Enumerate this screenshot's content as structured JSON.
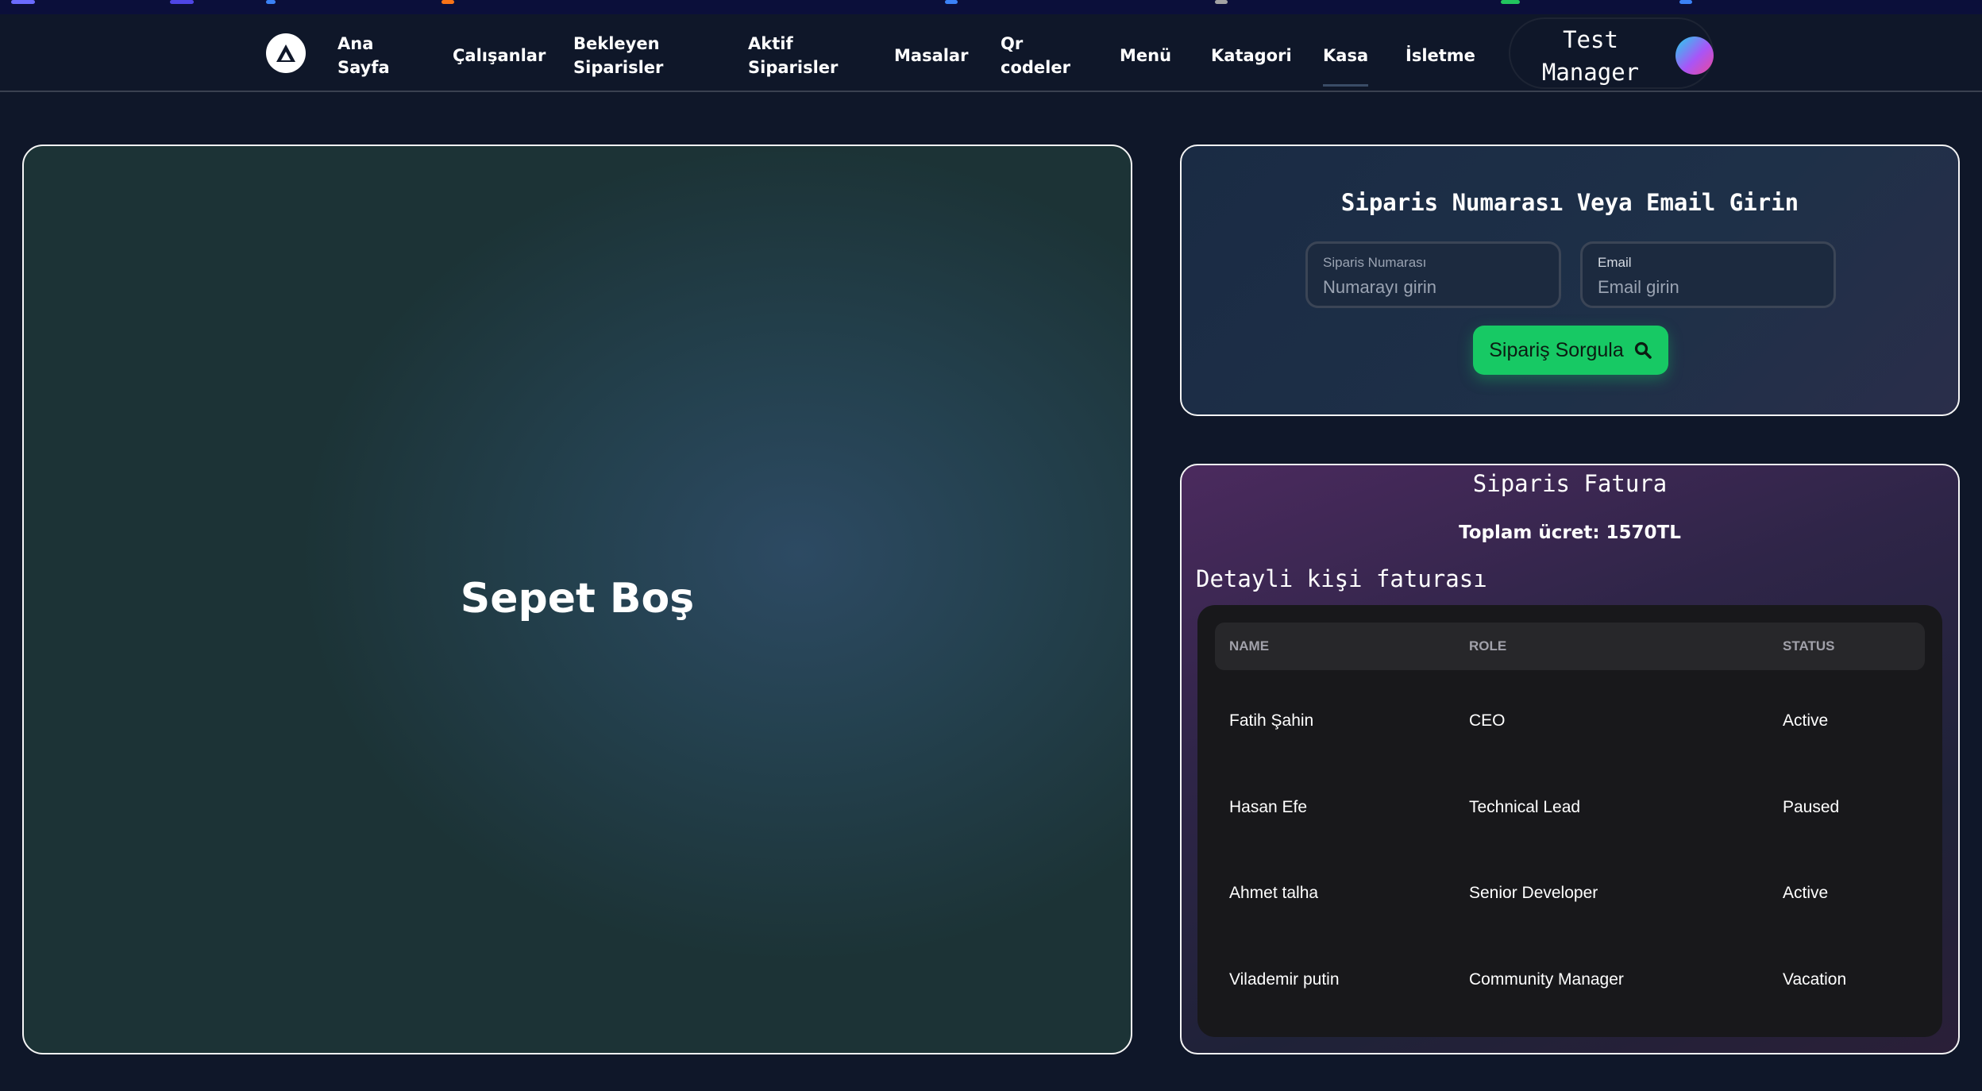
{
  "nav": {
    "items": [
      {
        "label": "Ana\nSayfa"
      },
      {
        "label": "Çalışanlar"
      },
      {
        "label": "Bekleyen\nSiparisler"
      },
      {
        "label": "Aktif\nSiparisler"
      },
      {
        "label": "Masalar"
      },
      {
        "label": "Qr\ncodeler"
      },
      {
        "label": "Menü"
      },
      {
        "label": "Katagori"
      },
      {
        "label": "Kasa"
      },
      {
        "label": "İsletme"
      }
    ],
    "active": "Kasa",
    "user_name": "Test Manager"
  },
  "cart": {
    "empty_text": "Sepet Boş"
  },
  "query": {
    "title": "Siparis Numarası Veya Email Girin",
    "order_label": "Siparis Numarası",
    "order_placeholder": "Numarayı girin",
    "email_label": "Email",
    "email_placeholder": "Email girin",
    "button_label": "Sipariş Sorgula"
  },
  "invoice": {
    "title": "Siparis Fatura",
    "total": "Toplam ücret: 1570TL",
    "subtitle": "Detayli kişi faturası",
    "columns": [
      "NAME",
      "ROLE",
      "STATUS"
    ],
    "rows": [
      {
        "name": "Fatih Şahin",
        "role": "CEO",
        "status": "Active"
      },
      {
        "name": "Hasan Efe",
        "role": "Technical Lead",
        "status": "Paused"
      },
      {
        "name": "Ahmet talha",
        "role": "Senior Developer",
        "status": "Active"
      },
      {
        "name": "Vilademir putin",
        "role": "Community Manager",
        "status": "Vacation"
      }
    ]
  },
  "colors": {
    "background": "#0f1729",
    "accent_green": "#17c964",
    "table_bg": "#18181b",
    "header_bg": "#27272a"
  }
}
